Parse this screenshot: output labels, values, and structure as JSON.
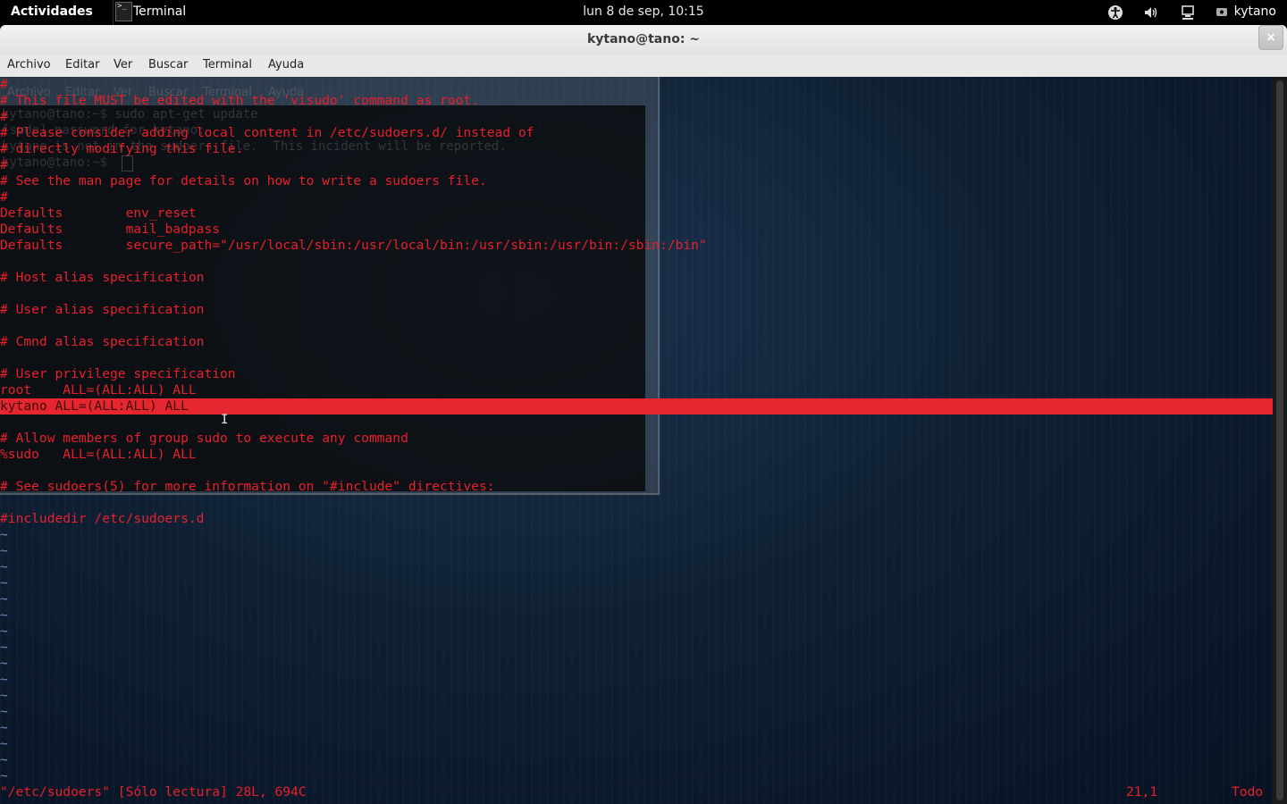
{
  "topbar": {
    "activities": "Actividades",
    "app_name": "Terminal",
    "app_icon_glyph": ">_",
    "clock": "lun  8 de sep, 10:15",
    "user": "kytano",
    "tray_icons": [
      "accessibility-icon",
      "volume-icon",
      "network-icon",
      "user-status-icon"
    ]
  },
  "window": {
    "title": "kytano@tano: ~",
    "close_glyph": "×"
  },
  "menu": [
    "Archivo",
    "Editar",
    "Ver",
    "Buscar",
    "Terminal",
    "Ayuda"
  ],
  "ghost": {
    "menu": [
      "Archivo",
      "Editar",
      "Ver",
      "Buscar",
      "Terminal",
      "Ayuda"
    ],
    "lines": [
      "kytano@tano:~$ sudo apt-get update",
      "[sudo] password for kytano:",
      "kytano is not in the sudoers file.  This incident will be reported.",
      "kytano@tano:~$ "
    ]
  },
  "editor": {
    "lines": [
      "#",
      "# This file MUST be edited with the 'visudo' command as root.",
      "#",
      "# Please consider adding local content in /etc/sudoers.d/ instead of",
      "# directly modifying this file.",
      "#",
      "# See the man page for details on how to write a sudoers file.",
      "#",
      "Defaults        env_reset",
      "Defaults        mail_badpass",
      "Defaults        secure_path=\"/usr/local/sbin:/usr/local/bin:/usr/sbin:/usr/bin:/sbin:/bin\"",
      "",
      "# Host alias specification",
      "",
      "# User alias specification",
      "",
      "# Cmnd alias specification",
      "",
      "# User privilege specification",
      "root    ALL=(ALL:ALL) ALL",
      "kytano ALL=(ALL:ALL) ALL",
      "",
      "# Allow members of group sudo to execute any command",
      "%sudo   ALL=(ALL:ALL) ALL",
      "",
      "# See sudoers(5) for more information on \"#include\" directives:",
      "",
      "#includedir /etc/sudoers.d"
    ],
    "highlighted_line_index": 20,
    "tilde_count": 16,
    "tilde_glyph": "~",
    "status_file": "\"/etc/sudoers\" [Sólo lectura] 28L, 694C",
    "status_position": "21,1",
    "status_scroll": "Todo"
  },
  "colors": {
    "text": "#e8202a",
    "highlight": "#e6262e",
    "tilde": "#6b8bb8"
  }
}
